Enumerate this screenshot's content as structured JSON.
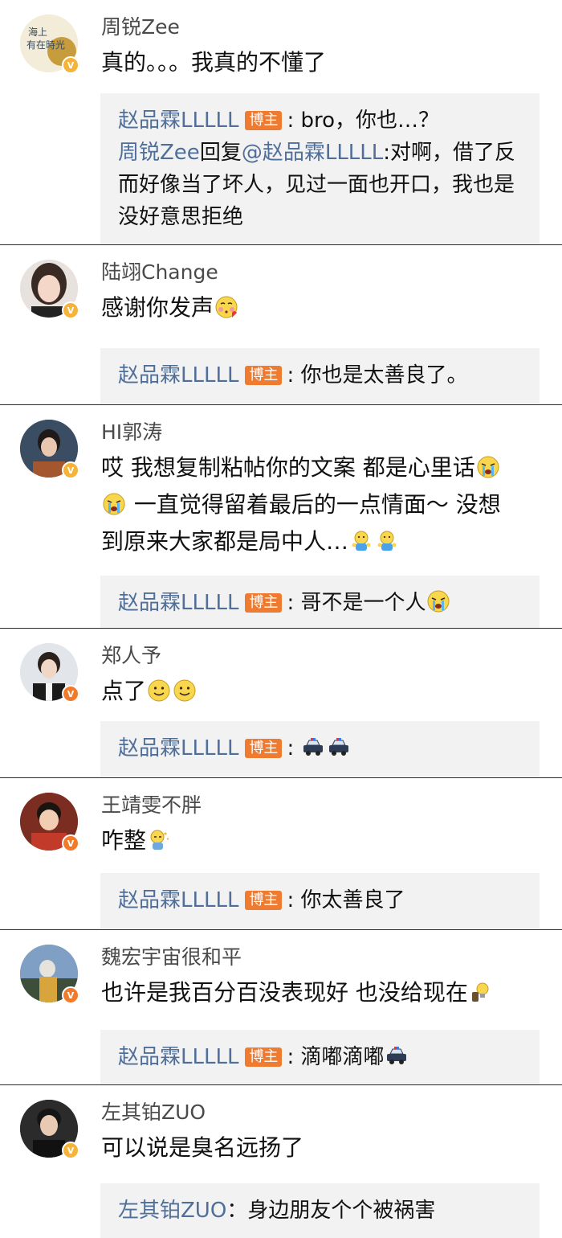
{
  "comments": [
    {
      "username": "周锐Zee",
      "text": "真的。。。我真的不懂了",
      "badge_color": "#f6b33a",
      "replies": [
        {
          "name": "赵品霖LLLLL",
          "badge": "博主",
          "text": ": bro，你也…？"
        },
        {
          "name": "周锐Zee",
          "mid": "回复",
          "mention": "@赵品霖LLLLL",
          "text": ":对啊，借了反而好像当了坏人，见过一面也开口，我也是没好意思拒绝"
        }
      ]
    },
    {
      "username": "陆翊Change",
      "text": "感谢你发声",
      "emojis": [
        "kiss-face-emoji"
      ],
      "badge_color": "#f6b33a",
      "reply": {
        "name": "赵品霖LLLLL",
        "badge": "博主",
        "text": ": 你也是太善良了。"
      }
    },
    {
      "username": "HI郭涛",
      "text_line1": "哎 我想复制粘帖你的文案 都是心里话",
      "text_line2": "一直觉得留着最后的一点情面～ 没想",
      "text_line3": "到原来大家都是局中人…",
      "emojis": [
        "crying-face-emoji",
        "hug-emoji"
      ],
      "badge_color": "#f6b33a",
      "reply": {
        "name": "赵品霖LLLLL",
        "badge": "博主",
        "text": ": 哥不是一个人"
      }
    },
    {
      "username": "郑人予",
      "text": "点了",
      "emojis": [
        "smile-face-emoji"
      ],
      "badge_color": "#f17a2b",
      "reply": {
        "name": "赵品霖LLLLL",
        "badge": "博主",
        "text": ":"
      }
    },
    {
      "username": "王靖雯不胖",
      "text": "咋整",
      "emojis": [
        "puzzled-emoji"
      ],
      "badge_color": "#f17a2b",
      "reply": {
        "name": "赵品霖LLLLL",
        "badge": "博主",
        "text": ": 你太善良了"
      }
    },
    {
      "username": "魏宏宇宙很和平",
      "text": "也许是我百分百没表现好 也没给现在",
      "emojis": [
        "lightbulb-emoji"
      ],
      "badge_color": "#f17a2b",
      "reply": {
        "name": "赵品霖LLLLL",
        "badge": "博主",
        "text": ": 滴嘟滴嘟"
      }
    },
    {
      "username": "左其铂ZUO",
      "text": "可以说是臭名远扬了",
      "badge_color": "#f6b33a",
      "reply": {
        "name": "左其铂ZUO",
        "text": "：身边朋友个个被祸害"
      }
    }
  ],
  "badge_letter": "V",
  "colors": {
    "reply_name": "#4f6f9a",
    "badge_bg": "#ee7b30",
    "reply_bg": "#f2f2f2"
  }
}
